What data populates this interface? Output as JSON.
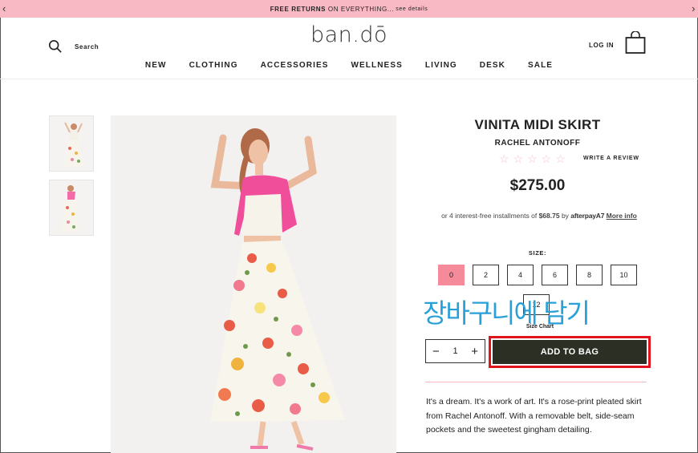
{
  "promo": {
    "bold_text": "FREE RETURNS",
    "text": "ON EVERYTHING...",
    "link": "see details",
    "prev_icon": "chevron-left-icon",
    "next_icon": "chevron-right-icon",
    "background": "#f8b9c4"
  },
  "header": {
    "search_label": "Search",
    "logo": "ban.dō",
    "login": "LOG IN",
    "nav": [
      "NEW",
      "CLOTHING",
      "ACCESSORIES",
      "WELLNESS",
      "LIVING",
      "DESK",
      "SALE"
    ]
  },
  "product": {
    "title": "VINITA MIDI SKIRT",
    "brand": "RACHEL ANTONOFF",
    "stars": "☆☆☆☆☆",
    "review_link": "WRITE A REVIEW",
    "price": "$275.00",
    "installments": {
      "prefix": "or 4 interest-free installments of",
      "amount": "$68.75",
      "by": "by",
      "provider": "afterpay",
      "provider_mark": "A7",
      "more": "More info"
    },
    "size_label": "SIZE:",
    "sizes": [
      "0",
      "2",
      "4",
      "6",
      "8",
      "10",
      "12"
    ],
    "selected_size": "0",
    "size_chart": "Size Chart",
    "quantity": "1",
    "qty_minus": "−",
    "qty_plus": "+",
    "add_to_bag": "ADD TO BAG",
    "description": "It's a dream. It's a work of art. It's a rose-print pleated skirt from Rachel Antonoff. With a removable belt, side-seam pockets and the sweetest gingham detailing."
  },
  "overlay_text": "장바구니에 담기",
  "colors": {
    "accent_pink": "#f58a9a",
    "button_dark": "#2c3024",
    "highlight_red": "#e0141c",
    "overlay_blue": "#2aa0d8"
  }
}
